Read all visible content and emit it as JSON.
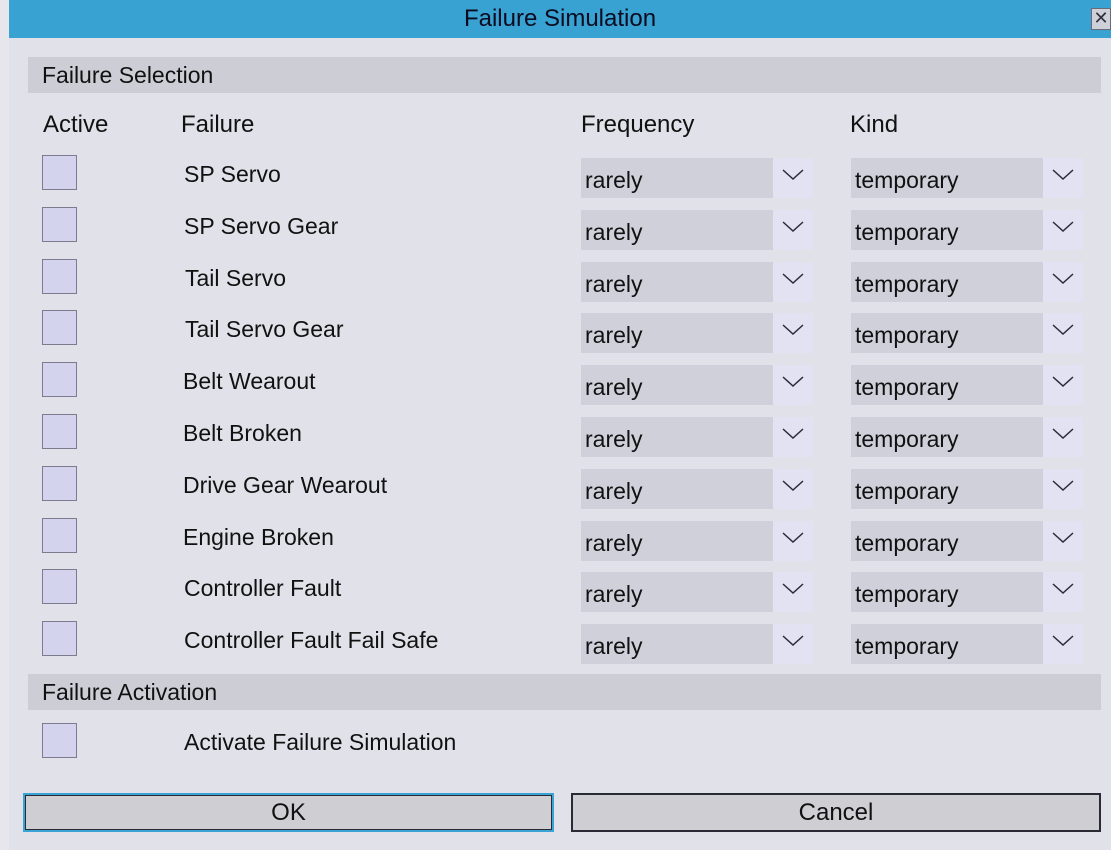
{
  "window": {
    "title": "Failure Simulation"
  },
  "selection": {
    "heading": "Failure Selection",
    "columns": {
      "active": "Active",
      "failure": "Failure",
      "frequency": "Frequency",
      "kind": "Kind"
    },
    "rows": [
      {
        "failure": "SP Servo",
        "active": false,
        "frequency": "rarely",
        "kind": "temporary"
      },
      {
        "failure": "SP Servo Gear",
        "active": false,
        "frequency": "rarely",
        "kind": "temporary"
      },
      {
        "failure": "Tail Servo",
        "active": false,
        "frequency": "rarely",
        "kind": "temporary"
      },
      {
        "failure": "Tail Servo Gear",
        "active": false,
        "frequency": "rarely",
        "kind": "temporary"
      },
      {
        "failure": "Belt Wearout",
        "active": false,
        "frequency": "rarely",
        "kind": "temporary"
      },
      {
        "failure": "Belt Broken",
        "active": false,
        "frequency": "rarely",
        "kind": "temporary"
      },
      {
        "failure": "Drive Gear Wearout",
        "active": false,
        "frequency": "rarely",
        "kind": "temporary"
      },
      {
        "failure": "Engine Broken",
        "active": false,
        "frequency": "rarely",
        "kind": "temporary"
      },
      {
        "failure": "Controller Fault",
        "active": false,
        "frequency": "rarely",
        "kind": "temporary"
      },
      {
        "failure": "Controller Fault Fail Safe",
        "active": false,
        "frequency": "rarely",
        "kind": "temporary"
      }
    ]
  },
  "activation": {
    "heading": "Failure Activation",
    "label": "Activate Failure Simulation",
    "active": false
  },
  "buttons": {
    "ok": "OK",
    "cancel": "Cancel"
  },
  "colors": {
    "titlebar": "#38a2d2",
    "panel": "#e1e1ea",
    "section": "#cdcdd6",
    "checkbox": "#d3d3ee",
    "focus": "#3aa3d6"
  },
  "icons": {
    "close": "close-icon",
    "dropdown": "chevron-down-icon"
  }
}
